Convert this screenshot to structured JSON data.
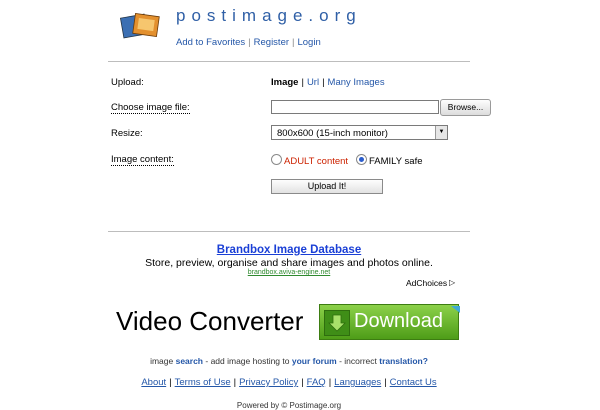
{
  "header": {
    "site_title": "postimage.org",
    "links": [
      "Add to Favorites",
      "Register",
      "Login"
    ]
  },
  "form": {
    "upload_label": "Upload:",
    "upload_modes": [
      "Image",
      "Url",
      "Many Images"
    ],
    "choose_file_label": "Choose image file:",
    "file_value": "",
    "browse_label": "Browse...",
    "resize_label": "Resize:",
    "resize_selected": "800x600 (15-inch monitor)",
    "content_label": "Image content:",
    "content_options": [
      "ADULT content",
      "FAMILY safe"
    ],
    "content_selected": "FAMILY safe",
    "submit_label": "Upload It!"
  },
  "ad": {
    "title": "Brandbox Image Database",
    "description": "Store, preview, organise and share images and photos online.",
    "url": "brandbox.aviva-engine.net",
    "adchoices": "AdChoices",
    "banner_text": "Video Converter",
    "banner_button": "Download"
  },
  "footer": {
    "line1_parts": [
      "image ",
      "search",
      " - add image hosting to ",
      "your forum",
      " - incorrect ",
      "translation?"
    ],
    "links": [
      "About",
      "Terms of Use",
      "Privacy Policy",
      "FAQ",
      "Languages",
      "Contact Us"
    ],
    "powered": "Powered by © Postimage.org"
  },
  "colors": {
    "link": "#2457a8",
    "title": "#2f5fa6",
    "adult": "#cc2200",
    "ad_title": "#1a3fd6",
    "download_green": "#5aac1e"
  }
}
